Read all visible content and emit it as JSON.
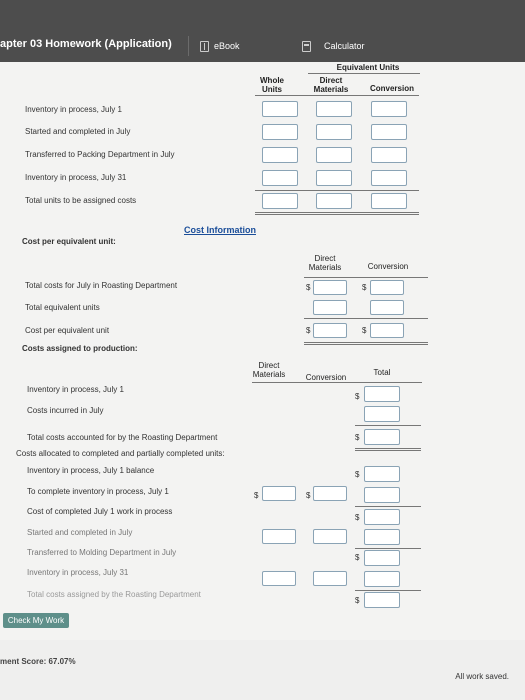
{
  "header": {
    "title": "apter 03 Homework (Application)",
    "ebook": "eBook",
    "calculator": "Calculator"
  },
  "units_section": {
    "equivalent_units": "Equivalent Units",
    "col_whole_units": [
      "Whole",
      "Units"
    ],
    "col_direct_materials": [
      "Direct",
      "Materials"
    ],
    "col_conversion": "Conversion",
    "rows": [
      "Inventory in process, July 1",
      "Started and completed in July",
      "Transferred to Packing Department in July",
      "Inventory in process, July 31",
      "Total units to be assigned costs"
    ]
  },
  "cost_info": {
    "title": "Cost Information",
    "cost_per_eu": "Cost per equivalent unit:",
    "col_direct_materials": [
      "Direct",
      "Materials"
    ],
    "col_conversion": "Conversion",
    "rows": [
      "Total costs for July in Roasting Department",
      "Total equivalent units",
      "Cost per equivalent unit",
      "Costs assigned to production:"
    ],
    "currency": "$"
  },
  "assigned_section": {
    "col_direct_materials": [
      "Direct",
      "Materials"
    ],
    "col_conversion": "Conversion",
    "col_total": "Total",
    "rows": [
      "Inventory in process, July 1",
      "Costs incurred in July",
      "Total costs accounted for by the Roasting Department",
      "Costs allocated to completed and partially completed units:",
      "Inventory in process, July 1 balance",
      "To complete inventory in process, July 1",
      "Cost of completed July 1 work in process",
      "Started and completed in July",
      "Transferred to Molding Department in July",
      "Inventory in process, July 31",
      "Total costs assigned by the Roasting Department"
    ]
  },
  "footer": {
    "check_button": "Check My Work",
    "score": "ment Score: 67.07%",
    "saved": "All work saved."
  }
}
